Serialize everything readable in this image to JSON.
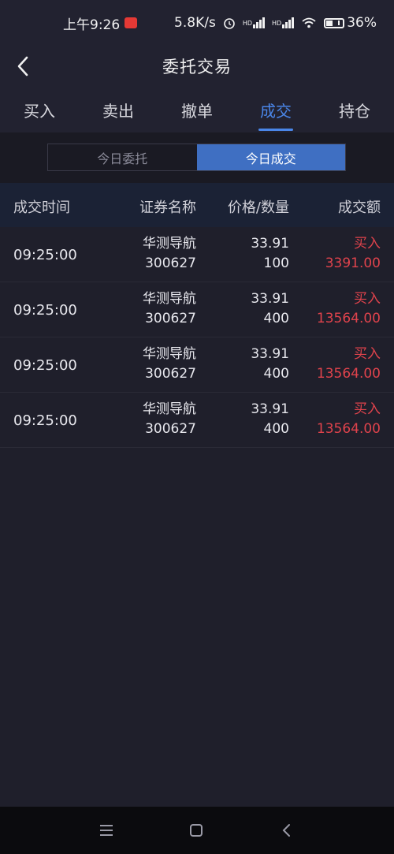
{
  "status_bar": {
    "time": "上午9:26",
    "speed": "5.8K/s",
    "battery": "36%",
    "network_1": "HD",
    "network_2": "HD",
    "icons": [
      "notification-icon",
      "alarm-icon",
      "signal-icon",
      "signal-icon",
      "wifi-icon",
      "battery-icon"
    ]
  },
  "header": {
    "title": "委托交易",
    "back_icon": "chevron-left-icon"
  },
  "tabs": [
    {
      "label": "买入",
      "active": false
    },
    {
      "label": "卖出",
      "active": false
    },
    {
      "label": "撤单",
      "active": false
    },
    {
      "label": "成交",
      "active": true
    },
    {
      "label": "持仓",
      "active": false
    }
  ],
  "segment": [
    {
      "label": "今日委托",
      "active": false
    },
    {
      "label": "今日成交",
      "active": true
    }
  ],
  "table": {
    "headers": [
      "成交时间",
      "证券名称",
      "价格/数量",
      "成交额"
    ],
    "rows": [
      {
        "time": "09:25:00",
        "name": "华测导航",
        "code": "300627",
        "price": "33.91",
        "qty": "100",
        "side": "买入",
        "amount": "3391.00"
      },
      {
        "time": "09:25:00",
        "name": "华测导航",
        "code": "300627",
        "price": "33.91",
        "qty": "400",
        "side": "买入",
        "amount": "13564.00"
      },
      {
        "time": "09:25:00",
        "name": "华测导航",
        "code": "300627",
        "price": "33.91",
        "qty": "400",
        "side": "买入",
        "amount": "13564.00"
      },
      {
        "time": "09:25:00",
        "name": "华测导航",
        "code": "300627",
        "price": "33.91",
        "qty": "400",
        "side": "买入",
        "amount": "13564.00"
      }
    ]
  },
  "colors": {
    "accent": "#4a86e8",
    "buy": "#e0434c",
    "background": "#1f1f2b"
  },
  "nav_bar": {
    "icons": [
      "menu-icon",
      "home-icon",
      "back-icon"
    ]
  }
}
